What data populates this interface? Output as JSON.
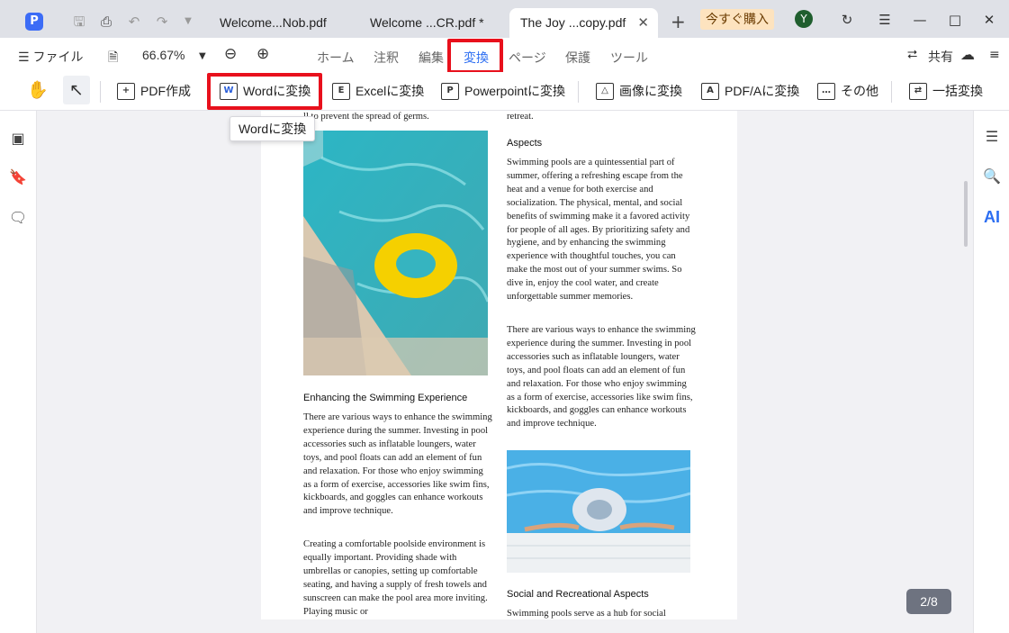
{
  "titlebar": {
    "tabs": [
      {
        "label": "Welcome...Nob.pdf"
      },
      {
        "label": "Welcome ...CR.pdf *"
      },
      {
        "label": "The Joy ...copy.pdf"
      }
    ],
    "buy_label": "今すぐ購入",
    "avatar_initial": "Y"
  },
  "menubar": {
    "file_label": "ファイル",
    "zoom_value": "66.67%",
    "tabs": [
      "ホーム",
      "注釈",
      "編集",
      "変換",
      "ページ",
      "保護",
      "ツール"
    ],
    "active_tab": "変換",
    "share_label": "共有"
  },
  "toolbar": {
    "create_pdf": "PDF作成",
    "to_word": "Wordに変換",
    "to_excel": "Excelに変換",
    "to_powerpoint": "Powerpointに変換",
    "to_image": "画像に変換",
    "to_pdfa": "PDF/Aに変換",
    "other": "その他",
    "batch": "一括変換"
  },
  "tooltip": "Wordに変換",
  "rightbar": {
    "ai_label": "AI"
  },
  "page_indicator": "2/8",
  "document": {
    "left_top_line": "ll to prevent the spread of germs.",
    "left_heading": "Enhancing the Swimming Experience",
    "left_para1": "There are various ways to enhance the swimming experience during the summer. Investing in pool accessories such as inflatable loungers, water toys, and pool floats can add an element of fun and relaxation. For those who enjoy swimming as a form of exercise, accessories like swim fins, kickboards, and goggles can enhance workouts and improve technique.",
    "left_para2": "Creating a comfortable poolside environment is equally important. Providing shade with umbrellas or canopies, setting up comfortable seating, and having a supply of fresh towels and sunscreen can make the pool area more inviting. Playing music or",
    "right_top_line": "retreat.",
    "right_heading1": "Aspects",
    "right_para1": "Swimming pools are a quintessential part of summer, offering a refreshing escape from the heat and a venue for both exercise and socialization. The physical, mental, and social benefits of swimming make it a favored activity for people of all ages. By prioritizing safety and hygiene, and by enhancing the swimming experience with thoughtful touches, you can make the most out of your summer swims. So dive in, enjoy the cool water, and create unforgettable summer memories.",
    "right_para2": "There are various ways to enhance the swimming experience during the summer. Investing in pool accessories such as inflatable loungers, water toys, and pool floats can add an element of fun and relaxation. For those who enjoy swimming as a form of exercise, accessories like swim fins, kickboards, and goggles can enhance workouts and improve technique.",
    "right_heading2": "Social and Recreational Aspects",
    "right_para3": "Swimming pools serve as a hub for social"
  },
  "colors": {
    "highlight": "#e8101c",
    "accent": "#2c6ef2",
    "buy_bg": "#fde3bf"
  }
}
